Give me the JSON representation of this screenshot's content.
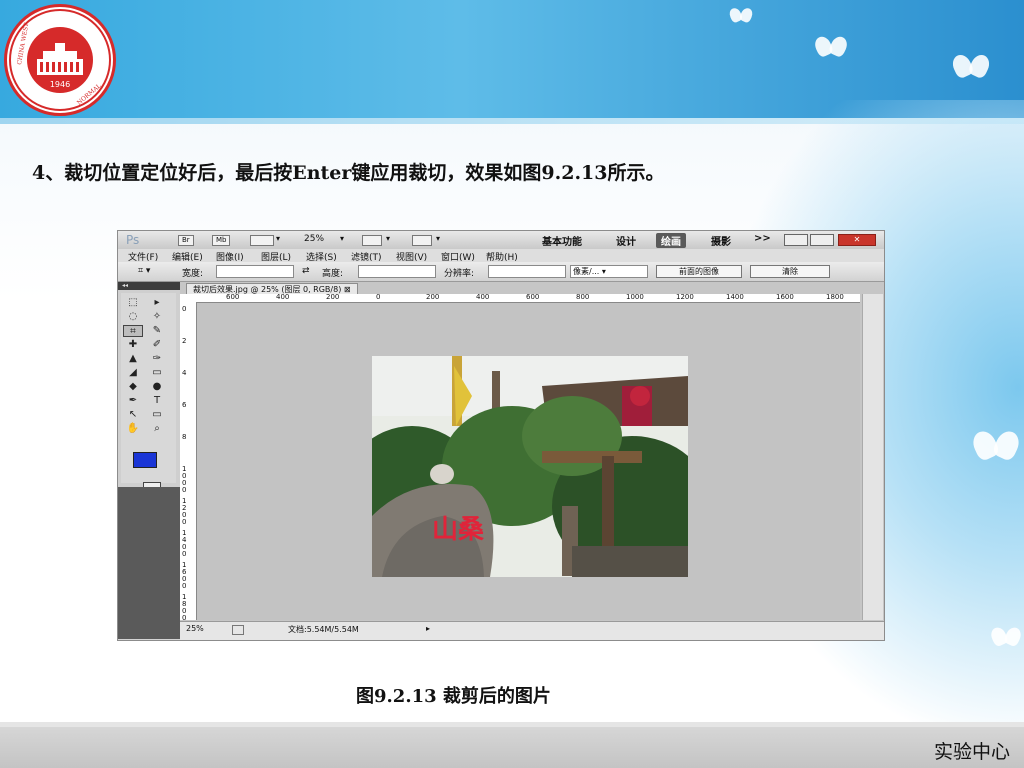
{
  "slide": {
    "instruction": "4、裁切位置定位好后，最后按Enter键应用裁切，效果如图9.2.13所示。",
    "caption": "图9.2.13 裁剪后的图片",
    "footer": "实验中心"
  },
  "logo": {
    "text": "CHINA WEST NORMAL UNIVERSITY",
    "year": "1946"
  },
  "photoshop": {
    "app_logo": "Ps",
    "badges": [
      "Br",
      "Mb"
    ],
    "zoom": "25%",
    "workspaces": [
      "基本功能",
      "设计",
      "绘画",
      "摄影",
      ">>"
    ],
    "active_workspace": "绘画",
    "menu": [
      "文件(F)",
      "编辑(E)",
      "图像(I)",
      "图层(L)",
      "选择(S)",
      "滤镜(T)",
      "视图(V)",
      "窗口(W)",
      "帮助(H)"
    ],
    "options": {
      "width_label": "宽度:",
      "height_label": "高度:",
      "resolution_label": "分辨率:",
      "unit": "像素/...",
      "front_image_button": "前面的图像",
      "clear_button": "清除"
    },
    "doc_tab": "裁切后效果.jpg @ 25% (图层 0, RGB/8)",
    "ruler_h": [
      "600",
      "400",
      "200",
      "0",
      "200",
      "400",
      "600",
      "800",
      "1000",
      "1200",
      "1400",
      "1600",
      "1800"
    ],
    "ruler_v": [
      "0",
      "2",
      "4",
      "6",
      "8",
      "1000",
      "1200",
      "1400",
      "1600",
      "1800"
    ],
    "status": {
      "zoom": "25%",
      "doc": "文档:5.54M/5.54M"
    },
    "photo_text": "山桑"
  }
}
